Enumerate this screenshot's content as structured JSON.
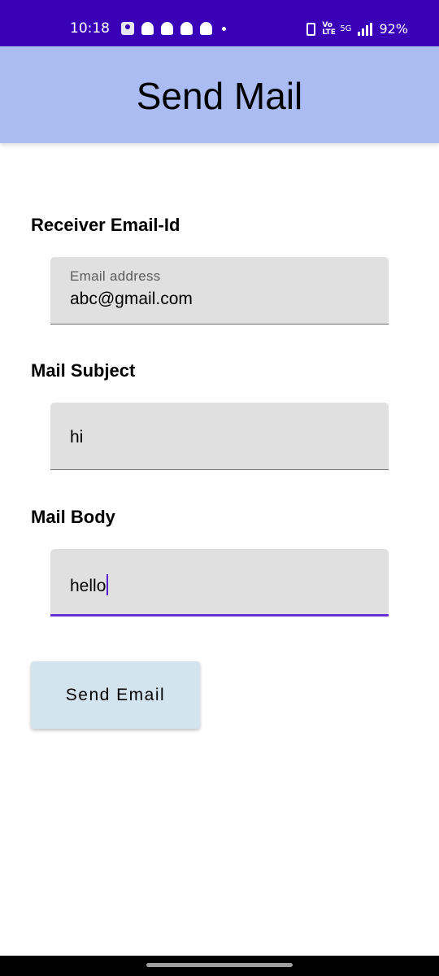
{
  "status_bar": {
    "time": "10:18",
    "network": "5G",
    "volte": "Vo LTE",
    "battery": "92%",
    "notification_icons": [
      "contacts-icon",
      "snapchat-icon",
      "snapchat-icon",
      "snapchat-icon",
      "snapchat-icon",
      "more-dot-icon"
    ],
    "background": "#3a00b8"
  },
  "app_bar": {
    "title": "Send Mail",
    "background": "#abbcf2"
  },
  "form": {
    "receiver": {
      "label": "Receiver Email-Id",
      "hint": "Email address",
      "value": "abc@gmail.com"
    },
    "subject": {
      "label": "Mail Subject",
      "value": "hi"
    },
    "body": {
      "label": "Mail Body",
      "value": "hello",
      "focused": true
    }
  },
  "send_button": {
    "label": "Send Email",
    "background": "#d3e4ef"
  },
  "colors": {
    "accent": "#6d2fd8",
    "field_background": "#e0e0e0"
  }
}
